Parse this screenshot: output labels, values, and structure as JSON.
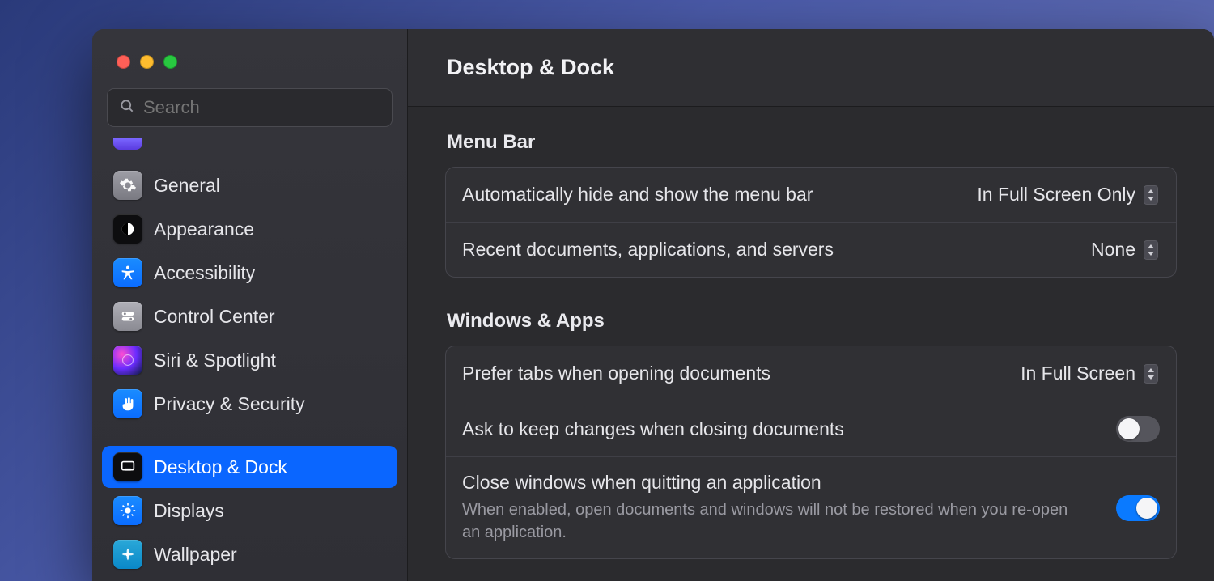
{
  "header": {
    "title": "Desktop & Dock"
  },
  "search": {
    "placeholder": "Search"
  },
  "sidebar": {
    "items": [
      {
        "label": "General"
      },
      {
        "label": "Appearance"
      },
      {
        "label": "Accessibility"
      },
      {
        "label": "Control Center"
      },
      {
        "label": "Siri & Spotlight"
      },
      {
        "label": "Privacy & Security"
      },
      {
        "label": "Desktop & Dock"
      },
      {
        "label": "Displays"
      },
      {
        "label": "Wallpaper"
      }
    ]
  },
  "sections": {
    "menubar": {
      "title": "Menu Bar",
      "rows": {
        "autohide": {
          "label": "Automatically hide and show the menu bar",
          "value": "In Full Screen Only"
        },
        "recents": {
          "label": "Recent documents, applications, and servers",
          "value": "None"
        }
      }
    },
    "windows": {
      "title": "Windows & Apps",
      "rows": {
        "tabs": {
          "label": "Prefer tabs when opening documents",
          "value": "In Full Screen"
        },
        "ask": {
          "label": "Ask to keep changes when closing documents",
          "on": false
        },
        "close": {
          "label": "Close windows when quitting an application",
          "sub": "When enabled, open documents and windows will not be restored when you re-open an application.",
          "on": true
        }
      }
    }
  }
}
